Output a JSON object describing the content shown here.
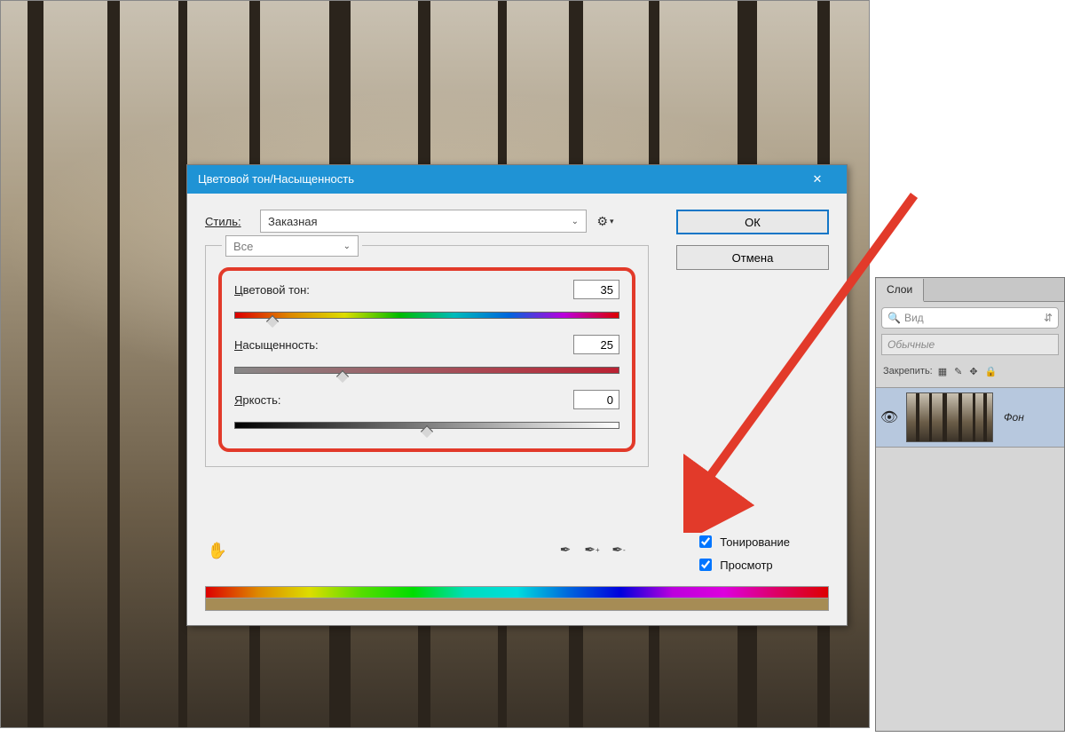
{
  "dialog": {
    "title": "Цветовой тон/Насыщенность",
    "close_symbol": "✕",
    "style_label": "Стиль:",
    "style_value": "Заказная",
    "edit_value": "Все",
    "gear_symbol": "⚙",
    "gear_arrow": "▾",
    "ok_label": "ОК",
    "cancel_label": "Отмена",
    "sliders": {
      "hue": {
        "label": "Цветовой тон:",
        "value": "35",
        "pos_pct": 10
      },
      "sat": {
        "label": "Насыщенность:",
        "value": "25",
        "pos_pct": 28
      },
      "light": {
        "label": "Яркость:",
        "value": "0",
        "pos_pct": 50
      }
    },
    "hand_symbol": "✋",
    "dropper_symbol": "✎",
    "colorize_label": "Тонирование",
    "preview_label": "Просмотр"
  },
  "layers": {
    "tab_label": "Слои",
    "search_icon": "🔍",
    "search_placeholder": "Вид",
    "search_arrow": "⇵",
    "blend_mode": "Обычные",
    "lock_label": "Закрепить:",
    "lock_icons": [
      "▦",
      "✎",
      "✥",
      "🔒"
    ],
    "visibility_icon": "👁",
    "layer_name": "Фон"
  }
}
